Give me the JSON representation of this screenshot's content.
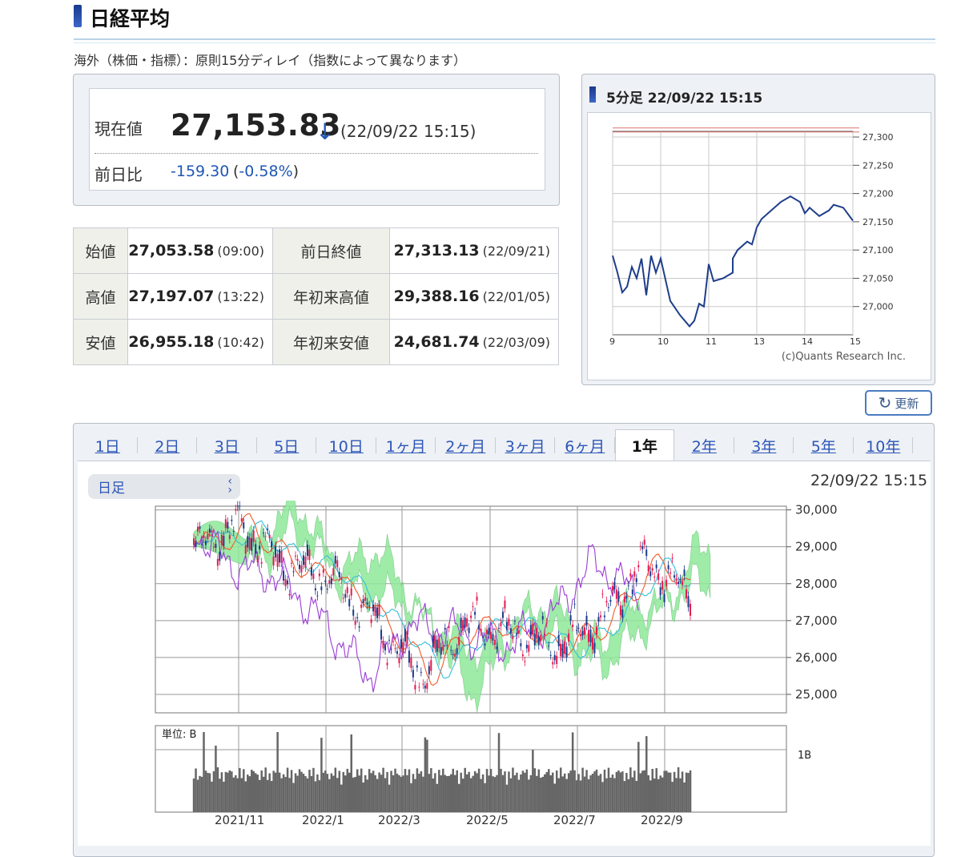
{
  "page": {
    "title": "日経平均",
    "delay_note": "海外（株価・指標）：原則15分ディレイ（指数によって異なります）"
  },
  "current": {
    "label": "現在値",
    "value": "27,153.83",
    "arrow": "↓",
    "time": "(22/09/22 15:15)",
    "change_label": "前日比",
    "change_value": "-159.30",
    "change_pct_open": "(",
    "change_pct": "-0.58%",
    "change_pct_close": ")"
  },
  "stats": [
    {
      "label": "始値",
      "value": "27,053.58",
      "time": "(09:00)",
      "label2": "前日終値",
      "value2": "27,313.13",
      "time2": "(22/09/21)"
    },
    {
      "label": "高値",
      "value": "27,197.07",
      "time": "(13:22)",
      "label2": "年初来高値",
      "value2": "29,388.16",
      "time2": "(22/01/05)"
    },
    {
      "label": "安値",
      "value": "26,955.18",
      "time": "(10:42)",
      "label2": "年初来安値",
      "value2": "24,681.74",
      "time2": "(22/03/09)"
    }
  ],
  "mini_chart": {
    "title": "5分足 22/09/22 15:15",
    "copyright": "(c)Quants Research Inc.",
    "y_ticks": [
      "27,300",
      "27,250",
      "27,200",
      "27,150",
      "27,100",
      "27,050",
      "27,000"
    ],
    "x_ticks": [
      "9",
      "10",
      "11",
      "13",
      "14",
      "15"
    ],
    "chart_data": {
      "type": "line",
      "x_hours": [
        9.0,
        9.1,
        9.2,
        9.3,
        9.4,
        9.5,
        9.6,
        9.7,
        9.8,
        9.9,
        10.0,
        10.2,
        10.4,
        10.6,
        10.7,
        10.8,
        10.9,
        11.0,
        11.1,
        11.3,
        11.5,
        12.5,
        12.6,
        12.8,
        12.9,
        13.0,
        13.1,
        13.3,
        13.5,
        13.7,
        13.9,
        14.0,
        14.1,
        14.3,
        14.5,
        14.6,
        14.8,
        15.0
      ],
      "values": [
        27090,
        27060,
        27025,
        27035,
        27070,
        27050,
        27085,
        27020,
        27090,
        27060,
        27085,
        27010,
        26985,
        26965,
        26975,
        27005,
        27000,
        27075,
        27045,
        27050,
        27060,
        27085,
        27100,
        27115,
        27110,
        27140,
        27155,
        27170,
        27185,
        27195,
        27185,
        27165,
        27175,
        27160,
        27170,
        27180,
        27175,
        27152
      ],
      "ylim": [
        26950,
        27310
      ],
      "reference_line": 27313.13
    }
  },
  "refresh": {
    "label": "更新",
    "icon": "refresh-icon"
  },
  "tabs": [
    "1日",
    "2日",
    "3日",
    "5日",
    "10日",
    "1ヶ月",
    "2ヶ月",
    "3ヶ月",
    "6ヶ月",
    "1年",
    "2年",
    "3年",
    "5年",
    "10年"
  ],
  "active_tab": "1年",
  "big_chart": {
    "select_value": "日足",
    "time": "22/09/22 15:15",
    "y_ticks": [
      "30,000",
      "29,000",
      "28,000",
      "27,000",
      "26,000",
      "25,000"
    ],
    "x_ticks": [
      "2021/11",
      "2022/1",
      "2022/3",
      "2022/5",
      "2022/7",
      "2022/9"
    ],
    "volume_label": "単位: B",
    "volume_tick": "1B",
    "chart_data": {
      "type": "line",
      "title": "",
      "x": [
        "2021/10",
        "2021/11",
        "2021/12",
        "2022/1",
        "2022/2",
        "2022/3",
        "2022/4",
        "2022/5",
        "2022/6",
        "2022/7",
        "2022/8",
        "2022/9"
      ],
      "series": [
        {
          "name": "",
          "values": [
            28900,
            29600,
            28500,
            28200,
            27000,
            25500,
            26900,
            26700,
            26300,
            27000,
            28600,
            27700
          ]
        }
      ],
      "ylim": [
        24500,
        30100
      ]
    }
  },
  "colors": {
    "up": "#e8184e",
    "down": "#1a3a8c",
    "kumo": "#8fe89a",
    "kumo2": "#c6ec78",
    "mini_line": "#1f3e8a"
  }
}
